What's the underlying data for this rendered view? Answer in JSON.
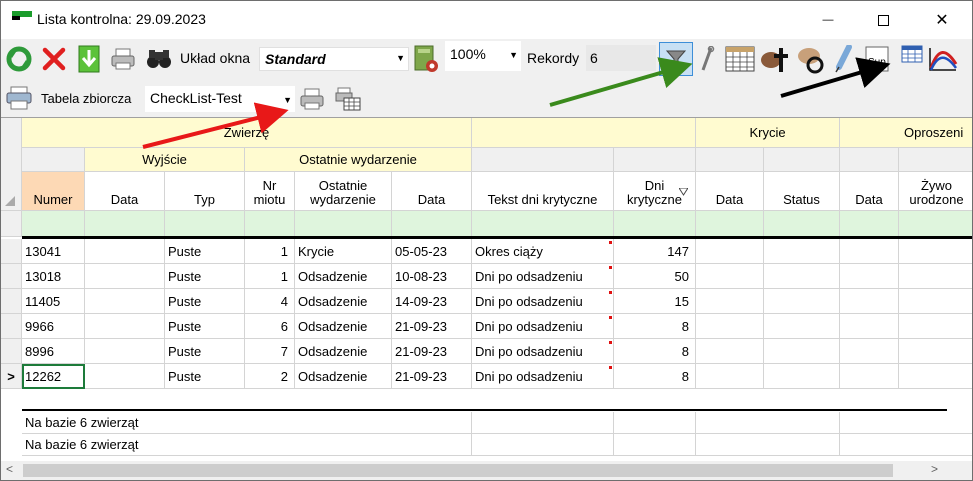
{
  "window": {
    "title": "Lista kontrolna: 29.09.2023",
    "minimize": "—",
    "close": "✕"
  },
  "toolbar1": {
    "layout_label": "Układ okna",
    "layout_value": "Standard",
    "zoom_value": "100%",
    "records_label": "Rekordy",
    "records_value": "6",
    "icons": [
      "refresh-icon",
      "delete-icon",
      "export-icon",
      "print-icon",
      "binoculars-icon",
      "settings-icon",
      "filter-icon",
      "wrench-icon",
      "calendar-grid-icon",
      "animal-cross-icon",
      "animal-refresh-icon",
      "syringe-icon",
      "sup-icon",
      "table-icon",
      "curve-chart-icon"
    ],
    "sup_text": "Sup"
  },
  "toolbar2": {
    "summary_label": "Tabela zbiorcza",
    "summary_value": "CheckList-Test"
  },
  "grid": {
    "group_headers": {
      "animal": "Zwierzę",
      "mating": "Krycie",
      "farrowing": "Oproszeni"
    },
    "subgroup_headers": {
      "exit": "Wyjście",
      "last_event": "Ostatnie wydarzenie"
    },
    "columns": {
      "number": "Numer",
      "exit_date": "Data",
      "type": "Typ",
      "litter_no": "Nr miotu",
      "last_event": "Ostatnie wydarzenie",
      "event_date": "Data",
      "critical_text": "Tekst dni krytyczne",
      "critical_days": "Dni krytyczne",
      "mating_date": "Data",
      "mating_status": "Status",
      "farrow_date": "Data",
      "live_born": "Żywo urodzone"
    },
    "rows": [
      {
        "number": "13041",
        "type": "Puste",
        "litter": "1",
        "event": "Krycie",
        "date": "05-05-23",
        "text": "Okres ciąży",
        "days": "147"
      },
      {
        "number": "13018",
        "type": "Puste",
        "litter": "1",
        "event": "Odsadzenie",
        "date": "10-08-23",
        "text": "Dni po odsadzeniu",
        "days": "50"
      },
      {
        "number": "11405",
        "type": "Puste",
        "litter": "4",
        "event": "Odsadzenie",
        "date": "14-09-23",
        "text": "Dni po odsadzeniu",
        "days": "15"
      },
      {
        "number": "9966",
        "type": "Puste",
        "litter": "6",
        "event": "Odsadzenie",
        "date": "21-09-23",
        "text": "Dni po odsadzeniu",
        "days": "8"
      },
      {
        "number": "8996",
        "type": "Puste",
        "litter": "7",
        "event": "Odsadzenie",
        "date": "21-09-23",
        "text": "Dni po odsadzeniu",
        "days": "8"
      },
      {
        "number": "12262",
        "type": "Puste",
        "litter": "2",
        "event": "Odsadzenie",
        "date": "21-09-23",
        "text": "Dni po odsadzeniu",
        "days": "8"
      }
    ],
    "current_row_marker": ">",
    "footer": [
      "Na bazie 6 zwierząt",
      "Na bazie 6 zwierząt"
    ]
  },
  "scrollbar": {
    "left_arrow": "<",
    "right_arrow": ">"
  },
  "colors": {
    "header_yellow": "#fffbd0",
    "header_orange": "#fdd9b5",
    "filter_green": "#dff5dd",
    "annotation_red": "#e81818",
    "annotation_green": "#3a8a1c",
    "annotation_black": "#000000"
  }
}
